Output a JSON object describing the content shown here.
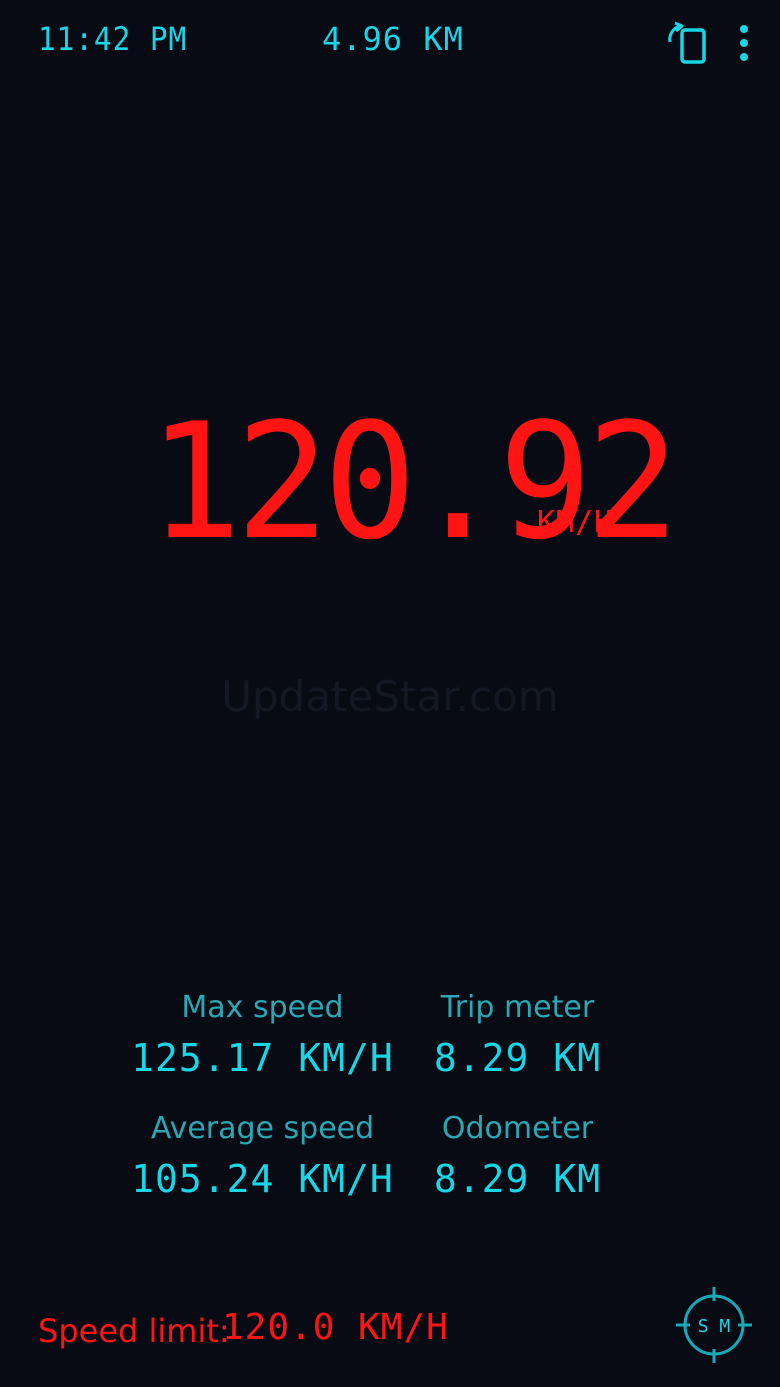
{
  "status": {
    "time": "11:42 PM",
    "distance": "4.96 KM"
  },
  "icons": {
    "rotate": "screen-rotate-icon",
    "menu": "more-vertical-icon",
    "sm": "crosshair-sm-icon"
  },
  "speedometer": {
    "speed": "120.92",
    "unit": "KM/H"
  },
  "watermark": "UpdateStar.com",
  "stats": {
    "max_speed": {
      "label": "Max speed",
      "value": "125.17 KM/H"
    },
    "trip_meter": {
      "label": "Trip meter",
      "value": "8.29 KM"
    },
    "average_speed": {
      "label": "Average speed",
      "value": "105.24 KM/H"
    },
    "odometer": {
      "label": "Odometer",
      "value": "8.29 KM"
    }
  },
  "speed_limit": {
    "label": "Speed limit:",
    "value": "120.0 KM/H"
  },
  "sm_button": {
    "label": "S M"
  },
  "colors": {
    "background": "#080a14",
    "accent_cyan": "#18d6e6",
    "label_teal": "#2aa7b3",
    "speed_red": "#ff1414"
  }
}
